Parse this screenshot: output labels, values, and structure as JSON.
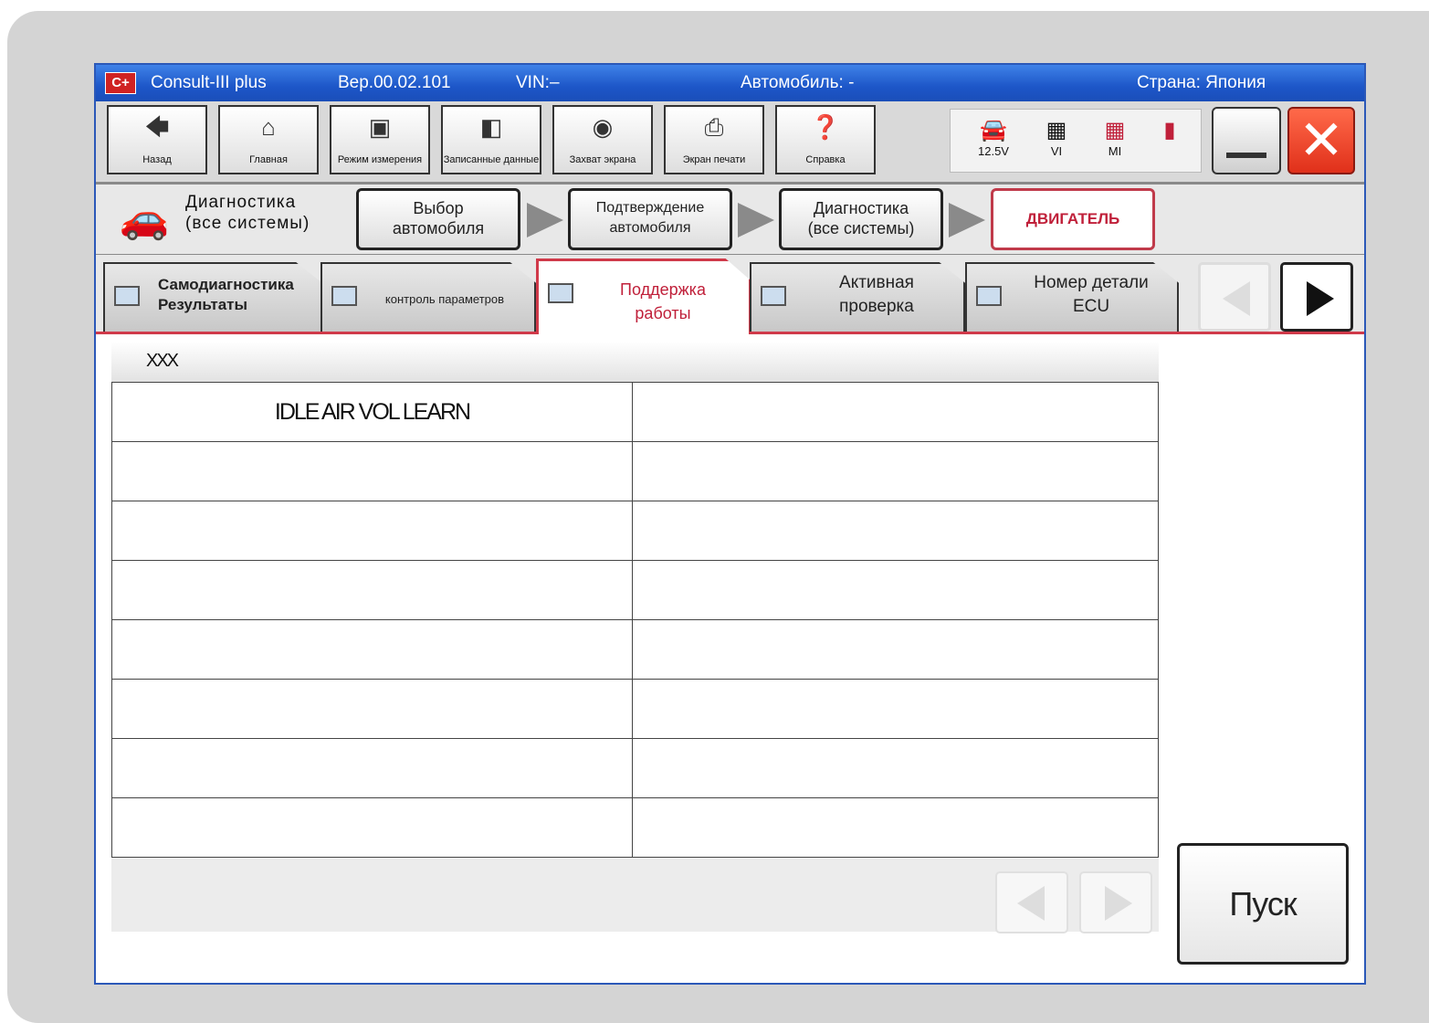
{
  "titlebar": {
    "app_name": "Consult-III plus",
    "version": "Вер.00.02.101",
    "vin": "VIN:–",
    "vehicle": "Автомобиль: -",
    "country": "Страна: Япония",
    "logo": "C+"
  },
  "toolbar": {
    "buttons": [
      {
        "label": "Назад",
        "icon": "back-arrow-icon"
      },
      {
        "label": "Главная",
        "icon": "home-icon"
      },
      {
        "label": "Режим измерения",
        "icon": "measure-mode-icon"
      },
      {
        "label": "Записанные данные",
        "icon": "recorded-data-icon"
      },
      {
        "label": "Захват экрана",
        "icon": "camera-icon"
      },
      {
        "label": "Экран печати",
        "icon": "printer-icon"
      },
      {
        "label": "Справка",
        "icon": "help-icon"
      }
    ],
    "status": {
      "battery_voltage": "12.5V",
      "vi": "VI",
      "mi": "MI"
    }
  },
  "navbar": {
    "section_title_line1": "Диагностика",
    "section_title_line2": "(все системы)",
    "steps": [
      {
        "line1": "Выбор",
        "line2": "автомобиля"
      },
      {
        "line1": "Подтверждение",
        "line2": "автомобиля"
      },
      {
        "line1": "Диагностика",
        "line2": "(все системы)"
      },
      {
        "line1": "ДВИГАТЕЛЬ",
        "line2": ""
      }
    ]
  },
  "tabs": [
    {
      "line1": "Самодиагностика",
      "line2": "Результаты"
    },
    {
      "line1": "контроль параметров",
      "line2": ""
    },
    {
      "line1": "Поддержка",
      "line2": "работы"
    },
    {
      "line1": "Активная",
      "line2": "проверка"
    },
    {
      "line1": "Номер детали",
      "line2": "ECU"
    }
  ],
  "panel": {
    "header": "XXX",
    "rows": [
      [
        "IDLE AIR VOL LEARN",
        ""
      ],
      [
        "",
        ""
      ],
      [
        "",
        ""
      ],
      [
        "",
        ""
      ],
      [
        "",
        ""
      ],
      [
        "",
        ""
      ],
      [
        "",
        ""
      ],
      [
        "",
        ""
      ]
    ]
  },
  "start_button": "Пуск"
}
